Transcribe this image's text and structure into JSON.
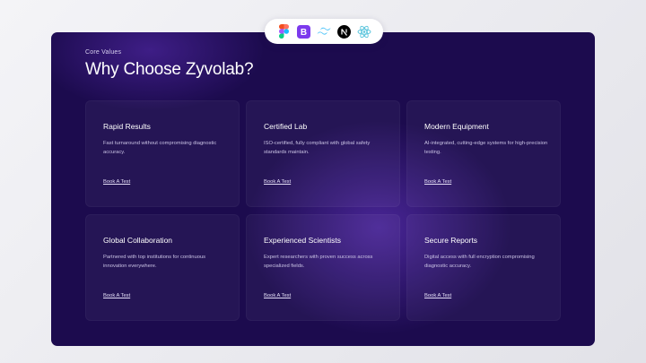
{
  "tech_icons": [
    {
      "name": "figma-icon"
    },
    {
      "name": "bootstrap-icon",
      "color": "#7c3aed"
    },
    {
      "name": "tailwind-icon",
      "color": "#38bdf8"
    },
    {
      "name": "nextjs-icon",
      "color": "#000000"
    },
    {
      "name": "react-icon",
      "color": "#58c4dc"
    }
  ],
  "section": {
    "eyebrow": "Core Values",
    "title": "Why Choose Zyvolab?"
  },
  "cards": [
    {
      "title": "Rapid Results",
      "description": "Fast turnaround without compromising diagnostic accuracy.",
      "link": "Book A Test"
    },
    {
      "title": "Certified Lab",
      "description": "ISO-certified, fully compliant with global safety standards maintain.",
      "link": "Book A Test"
    },
    {
      "title": "Modern Equipment",
      "description": "AI-integrated, cutting-edge systems for high-precision testing.",
      "link": "Book A Test"
    },
    {
      "title": "Global Collaboration",
      "description": "Partnered with top institutions for continuous innovation everywhere.",
      "link": "Book A Test"
    },
    {
      "title": "Experienced Scientists",
      "description": "Expert researchers with proven success across specialized fields.",
      "link": "Book A Test"
    },
    {
      "title": "Secure Reports",
      "description": "Digital access with full encryption compromising diagnostic accuracy.",
      "link": "Book A Test"
    }
  ],
  "colors": {
    "panel_background": "#1c0b4e",
    "card_background": "rgba(255,255,255,0.045)",
    "accent_glow": "#6e3cd2"
  }
}
